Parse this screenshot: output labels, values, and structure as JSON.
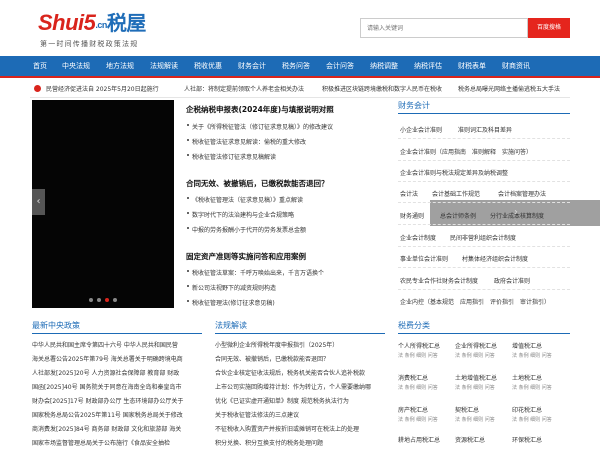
{
  "header": {
    "logo_main": "Shui5",
    "logo_cn": ".cn",
    "logo_zh": "税屋",
    "logo_sub": "第一时间传播财税政策法规",
    "search_placeholder": "请输入关键词",
    "search_button": "百度搜格"
  },
  "nav": [
    "首页",
    "中央法规",
    "地方法规",
    "法规解读",
    "税收优惠",
    "财务会计",
    "税务问答",
    "会计问答",
    "纳税调整",
    "纳税评估",
    "财税表单",
    "财商资讯"
  ],
  "ticker": [
    "民营经济促进法自 2025年5月20日起施行",
    "人社部：将制定提前领取个人养老金相关办法",
    "积极推进区块链跨境缴税和数字人民币在税收",
    "税务总局曝光网络主播偷逃税五大手法"
  ],
  "center": {
    "sections": [
      {
        "title": "企税纳税申报表(2024年度)与填报说明对照",
        "items": [
          "关于《所得税征管法（修订征求意见稿）》的修改建议",
          "税收征管法征求意见解读：偷税的重大修改",
          "税收征管法修订征求意见稿解读"
        ]
      },
      {
        "title": "合同无效、被撤销后，已缴税款能否退回？",
        "items": [
          "《税收征管理法（征求意见稿）》重点解读",
          "数字时代下的法治建构与企业合规策略",
          "中报的劳务报酬小于代开的劳务发票总金额"
        ]
      },
      {
        "title": "固定资产准则等实施问答和应用案例",
        "items": [
          "税收征管法草案：千呼万唤始出来，千言万语换个",
          "新公司法视野下的减资规则构造",
          "税收征管理法(修订征求意见稿)"
        ]
      }
    ]
  },
  "accounting": {
    "title": "财务会计",
    "rows": [
      [
        "小企业会计准则",
        "准则词汇及科目差异"
      ],
      [
        "企业会计准则（应用指南　准则解释　实施问答）"
      ],
      [
        "企业会计准则与税法规定差异及纳税调整"
      ],
      [
        "会计法",
        "会计基础工作规范",
        "会计档案管理办法"
      ],
      [
        "财务通则",
        "总会计师条例",
        "分行业成本核算制度"
      ],
      [
        "企业会计制度",
        "民间非营利组织会计制度"
      ],
      [
        "事业单位会计准则",
        "村集体经济组织会计制度"
      ],
      [
        "农民专业合作社财务会计制度",
        "政府会计准则"
      ],
      [
        "企业内控（基本规范　应用指引　评价指引　审计指引）"
      ]
    ]
  },
  "central": {
    "title": "最新中央政策",
    "rows": [
      "中华人民共和国主席令第四十六号 中华人民共和国民营",
      "海关总署公告2025年第79号 海关总署关于明确跨境电商",
      "人社部发[2025]20号 人力资源社会保障部 教育部 财政",
      "国函[2025]40号 国务院关于同意在海南全岛和秦皇岛市",
      "财办会[2025]17号 财政部办公厅 生态环境部办公厅关于",
      "国家税务总局公告2025年第11号 国家税务总局关于修改",
      "商消费发[2025]84号 商务部 财政部 文化和旅游部 海关",
      "国家市场监督管理总局关于公布施行《食品安全抽检"
    ]
  },
  "interpret": {
    "title": "法规解读",
    "rows": [
      "小型微利企业所得税年度申报指引（2025年）",
      "合同无效、被撤销后，已缴税款能否退回？",
      "合伙企业核定征收法规后，税务机关能否合伙人追补税款",
      "上市公司实施回购增持计划：作为转让方，个人需要缴纳哪",
      "优化《已证实虚开通知单》制度 规范税务执法行为",
      "关于税收征管法修法的三点建议",
      "不征税收入购置资产并按折旧或摊销可在税法上的处理",
      "积分兑换、积分互换支付的税务处理问题"
    ]
  },
  "tax": {
    "title": "税费分类",
    "sub": "法 条例 细则 问答",
    "items": [
      [
        "个人所得税汇总",
        "企业所得税汇总",
        "增值税汇总"
      ],
      [
        "消费税汇总",
        "土地增值税汇总",
        "土地税汇总"
      ],
      [
        "房产税汇总",
        "契税汇总",
        "印花税汇总"
      ],
      [
        "耕地占用税汇总",
        "资源税汇总",
        "环保税汇总"
      ]
    ]
  },
  "colors": {
    "brand_blue": "#1d6bb6",
    "brand_red": "#d9241c",
    "slider_bg": "#050505"
  }
}
